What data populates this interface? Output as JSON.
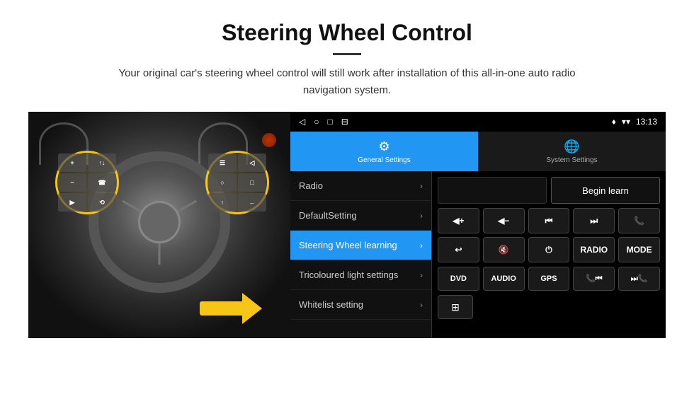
{
  "header": {
    "title": "Steering Wheel Control",
    "subtitle": "Your original car's steering wheel control will still work after installation of this all-in-one auto radio navigation system."
  },
  "status_bar": {
    "time": "13:13",
    "icons": [
      "◁",
      "○",
      "□",
      "⊟"
    ],
    "right_icons": [
      "signal",
      "wifi",
      "battery"
    ]
  },
  "tabs": [
    {
      "label": "General Settings",
      "icon": "⚙",
      "active": true
    },
    {
      "label": "System Settings",
      "icon": "🌐",
      "active": false
    }
  ],
  "menu_items": [
    {
      "label": "Radio",
      "active": false
    },
    {
      "label": "DefaultSetting",
      "active": false
    },
    {
      "label": "Steering Wheel learning",
      "active": true
    },
    {
      "label": "Tricoloured light settings",
      "active": false
    },
    {
      "label": "Whitelist setting",
      "active": false
    }
  ],
  "right_panel": {
    "begin_learn_label": "Begin learn",
    "grid_buttons": [
      {
        "label": "◀+",
        "type": "vol_up"
      },
      {
        "label": "◀−",
        "type": "vol_down"
      },
      {
        "label": "⏮",
        "type": "prev"
      },
      {
        "label": "⏭",
        "type": "next"
      },
      {
        "label": "☎",
        "type": "call"
      },
      {
        "label": "↩",
        "type": "back_call"
      },
      {
        "label": "🔇",
        "type": "mute"
      },
      {
        "label": "⏻",
        "type": "power"
      },
      {
        "label": "RADIO",
        "type": "radio"
      },
      {
        "label": "MODE",
        "type": "mode"
      }
    ],
    "bottom_buttons": [
      {
        "label": "DVD"
      },
      {
        "label": "AUDIO"
      },
      {
        "label": "GPS"
      },
      {
        "label": "☎⏮",
        "combined": true
      },
      {
        "label": "⏭☎",
        "combined": true
      }
    ],
    "last_row_icon": "⊞"
  },
  "car_controls": {
    "left_buttons": [
      "+",
      "↑↓",
      "−",
      "☎",
      "▶",
      "⟲"
    ],
    "right_buttons": [
      "☰",
      "◁",
      "○",
      "□",
      "↑",
      "←"
    ]
  }
}
